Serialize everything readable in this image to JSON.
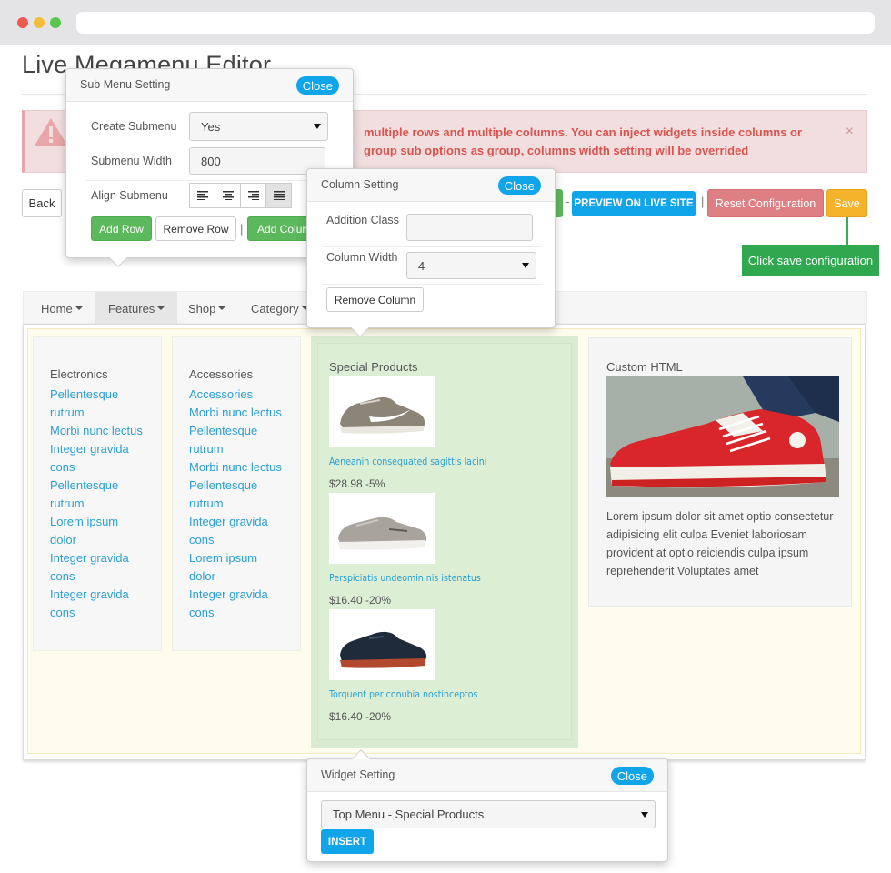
{
  "page": {
    "title": "Live Megamenu Editor"
  },
  "alert": {
    "text": "multiple rows and multiple columns. You can inject widgets inside columns or group sub options as group, columns width setting will be overrided",
    "close": "×"
  },
  "toolbar": {
    "back_label": "Back",
    "preview_label": "PREVIEW ON LIVE SITE",
    "reset_label": "Reset Configuration",
    "save_label": "Save",
    "dash": "-",
    "bar": "|",
    "save_tip": "Click save configuration"
  },
  "nav": {
    "items": [
      {
        "label": "Home"
      },
      {
        "label": "Features"
      },
      {
        "label": "Shop"
      },
      {
        "label": "Category"
      }
    ]
  },
  "columns": {
    "electronics": {
      "title": "Electronics",
      "links": [
        "Pellentesque",
        "rutrum",
        "Morbi nunc lectus",
        "Integer gravida",
        "cons",
        "Pellentesque",
        "rutrum",
        "Lorem ipsum",
        "dolor",
        "Integer gravida",
        "cons",
        "Integer gravida",
        "cons"
      ]
    },
    "accessories": {
      "title": "Accessories",
      "links": [
        "Accessories",
        "Morbi nunc lectus",
        "Pellentesque",
        "rutrum",
        "Morbi nunc lectus",
        "Pellentesque",
        "rutrum",
        "Integer gravida",
        "cons",
        "Lorem ipsum",
        "dolor",
        "Integer gravida",
        "cons"
      ]
    },
    "special": {
      "title": "Special Products",
      "products": [
        {
          "name": "Aeneanin consequated sagittis lacini",
          "price": "$28.98 -5%"
        },
        {
          "name": "Perspiciatis undeomin nis istenatus",
          "price": "$16.40 -20%"
        },
        {
          "name": "Torquent per conubia nostinceptos",
          "price": "$16.40 -20%"
        }
      ]
    },
    "custom": {
      "title": "Custom HTML",
      "text": "Lorem ipsum dolor sit amet optio consectetur adipisicing elit culpa Eveniet laboriosam provident at optio reiciendis culpa ipsum reprehenderit Voluptates amet"
    }
  },
  "submenu_popover": {
    "title": "Sub Menu Setting",
    "close": "Close",
    "create_label": "Create Submenu",
    "create_value": "Yes",
    "width_label": "Submenu Width",
    "width_value": "800",
    "align_label": "Align Submenu",
    "add_row": "Add Row",
    "remove_row": "Remove Row",
    "sep": "|",
    "add_column": "Add Column"
  },
  "column_popover": {
    "title": "Column Setting",
    "close": "Close",
    "class_label": "Addition Class",
    "class_value": "",
    "width_label": "Column Width",
    "width_value": "4",
    "remove_column": "Remove Column"
  },
  "widget_popover": {
    "title": "Widget Setting",
    "close": "Close",
    "widget_value": "Top Menu - Special Products",
    "insert": "INSERT"
  },
  "colors": {
    "accent": "#10a4e8",
    "success": "#5cb85c",
    "danger": "#dd7f83",
    "warning": "#f4b32a",
    "link": "#2a9fd6"
  }
}
